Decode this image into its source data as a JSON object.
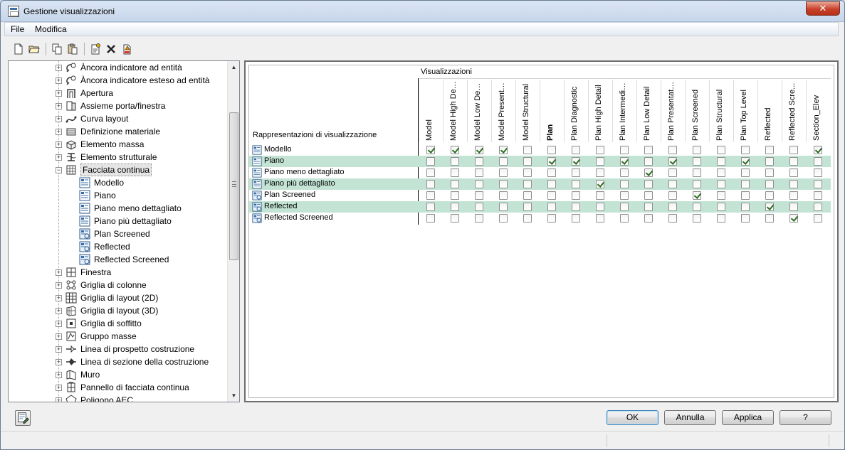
{
  "window": {
    "title": "Gestione visualizzazioni"
  },
  "menu": {
    "file": "File",
    "edit": "Modifica"
  },
  "toolbar": {
    "buttons": [
      "new-icon",
      "open-icon",
      "copy-icon",
      "paste-icon",
      "properties-icon",
      "delete-icon",
      "purge-icon"
    ]
  },
  "tree": {
    "items": [
      {
        "label": "Àncora indicatore ad entità",
        "icon": "anchor-tag-icon",
        "expander": "+",
        "level": 0
      },
      {
        "label": "Àncora indicatore esteso ad entità",
        "icon": "anchor-tag-icon",
        "expander": "+",
        "level": 0
      },
      {
        "label": "Apertura",
        "icon": "opening-icon",
        "expander": "+",
        "level": 0
      },
      {
        "label": "Assieme porta/finestra",
        "icon": "door-window-icon",
        "expander": "+",
        "level": 0
      },
      {
        "label": "Curva layout",
        "icon": "layout-curve-icon",
        "expander": "+",
        "level": 0
      },
      {
        "label": "Definizione materiale",
        "icon": "material-icon",
        "expander": "+",
        "level": 0
      },
      {
        "label": "Elemento massa",
        "icon": "mass-element-icon",
        "expander": "+",
        "level": 0
      },
      {
        "label": "Elemento strutturale",
        "icon": "structural-icon",
        "expander": "+",
        "level": 0
      },
      {
        "label": "Facciata continua",
        "icon": "curtain-wall-icon",
        "expander": "−",
        "level": 0,
        "selected": true
      },
      {
        "label": "Modello",
        "icon": "display-rep-icon",
        "expander": "",
        "level": 1
      },
      {
        "label": "Piano",
        "icon": "display-rep-icon",
        "expander": "",
        "level": 1
      },
      {
        "label": "Piano meno dettagliato",
        "icon": "display-rep-icon",
        "expander": "",
        "level": 1
      },
      {
        "label": "Piano più dettagliato",
        "icon": "display-rep-icon",
        "expander": "",
        "level": 1
      },
      {
        "label": "Plan Screened",
        "icon": "display-rep-icon-blue",
        "expander": "",
        "level": 1
      },
      {
        "label": "Reflected",
        "icon": "display-rep-icon-blue",
        "expander": "",
        "level": 1
      },
      {
        "label": "Reflected Screened",
        "icon": "display-rep-icon-blue",
        "expander": "",
        "level": 1
      },
      {
        "label": "Finestra",
        "icon": "window-icon",
        "expander": "+",
        "level": 0
      },
      {
        "label": "Griglia di colonne",
        "icon": "column-grid-icon",
        "expander": "+",
        "level": 0
      },
      {
        "label": "Griglia di layout (2D)",
        "icon": "layout-grid-2d-icon",
        "expander": "+",
        "level": 0
      },
      {
        "label": "Griglia di layout (3D)",
        "icon": "layout-grid-3d-icon",
        "expander": "+",
        "level": 0
      },
      {
        "label": "Griglia di soffitto",
        "icon": "ceiling-grid-icon",
        "expander": "+",
        "level": 0
      },
      {
        "label": "Gruppo masse",
        "icon": "mass-group-icon",
        "expander": "+",
        "level": 0
      },
      {
        "label": "Linea di prospetto costruzione",
        "icon": "elevation-line-icon",
        "expander": "+",
        "level": 0
      },
      {
        "label": "Linea di sezione della costruzione",
        "icon": "section-line-icon",
        "expander": "+",
        "level": 0
      },
      {
        "label": "Muro",
        "icon": "wall-icon",
        "expander": "+",
        "level": 0
      },
      {
        "label": "Pannello di facciata continua",
        "icon": "curtain-panel-icon",
        "expander": "+",
        "level": 0
      },
      {
        "label": "Poligono AEC",
        "icon": "polygon-icon",
        "expander": "+",
        "level": 0
      }
    ]
  },
  "grid": {
    "group_header": "Visualizzazioni",
    "row_header": "Rappresentazioni di visualizzazione",
    "columns": [
      {
        "label": "Model",
        "bold": false
      },
      {
        "label": "Model High Det...",
        "bold": false
      },
      {
        "label": "Model Low Detail",
        "bold": false
      },
      {
        "label": "Model Presenta...",
        "bold": false
      },
      {
        "label": "Model Structural",
        "bold": false
      },
      {
        "label": "Plan",
        "bold": true
      },
      {
        "label": "Plan Diagnostic",
        "bold": false
      },
      {
        "label": "Plan High Detail",
        "bold": false
      },
      {
        "label": "Plan Intermedia...",
        "bold": false
      },
      {
        "label": "Plan Low Detail",
        "bold": false
      },
      {
        "label": "Plan Presentation",
        "bold": false
      },
      {
        "label": "Plan Screened",
        "bold": false
      },
      {
        "label": "Plan Structural",
        "bold": false
      },
      {
        "label": "Plan Top Level",
        "bold": false
      },
      {
        "label": "Reflected",
        "bold": false
      },
      {
        "label": "Reflected Scre...",
        "bold": false
      },
      {
        "label": "Section_Elev",
        "bold": false
      }
    ],
    "rows": [
      {
        "label": "Modello",
        "band": false,
        "checks": [
          1,
          1,
          1,
          1,
          0,
          0,
          0,
          0,
          0,
          0,
          0,
          0,
          0,
          0,
          0,
          0,
          1
        ]
      },
      {
        "label": "Piano",
        "band": true,
        "checks": [
          0,
          0,
          0,
          0,
          0,
          1,
          1,
          0,
          1,
          0,
          1,
          0,
          0,
          1,
          0,
          0,
          0
        ]
      },
      {
        "label": "Piano meno dettagliato",
        "band": false,
        "checks": [
          0,
          0,
          0,
          0,
          0,
          0,
          0,
          0,
          0,
          1,
          0,
          0,
          0,
          0,
          0,
          0,
          0
        ]
      },
      {
        "label": "Piano più dettagliato",
        "band": true,
        "checks": [
          0,
          0,
          0,
          0,
          0,
          0,
          0,
          1,
          0,
          0,
          0,
          0,
          0,
          0,
          0,
          0,
          0
        ]
      },
      {
        "label": "Plan Screened",
        "band": false,
        "checks": [
          0,
          0,
          0,
          0,
          0,
          0,
          0,
          0,
          0,
          0,
          0,
          1,
          0,
          0,
          0,
          0,
          0
        ]
      },
      {
        "label": "Reflected",
        "band": true,
        "checks": [
          0,
          0,
          0,
          0,
          0,
          0,
          0,
          0,
          0,
          0,
          0,
          0,
          0,
          0,
          1,
          0,
          0
        ]
      },
      {
        "label": "Reflected Screened",
        "band": false,
        "checks": [
          0,
          0,
          0,
          0,
          0,
          0,
          0,
          0,
          0,
          0,
          0,
          0,
          0,
          0,
          0,
          1,
          0
        ]
      }
    ]
  },
  "buttons": {
    "ok": "OK",
    "cancel": "Annulla",
    "apply": "Applica",
    "help": "?"
  },
  "colors": {
    "band": "#c3e4d5",
    "check": "#2a6d1f",
    "close": "#c8412a"
  }
}
